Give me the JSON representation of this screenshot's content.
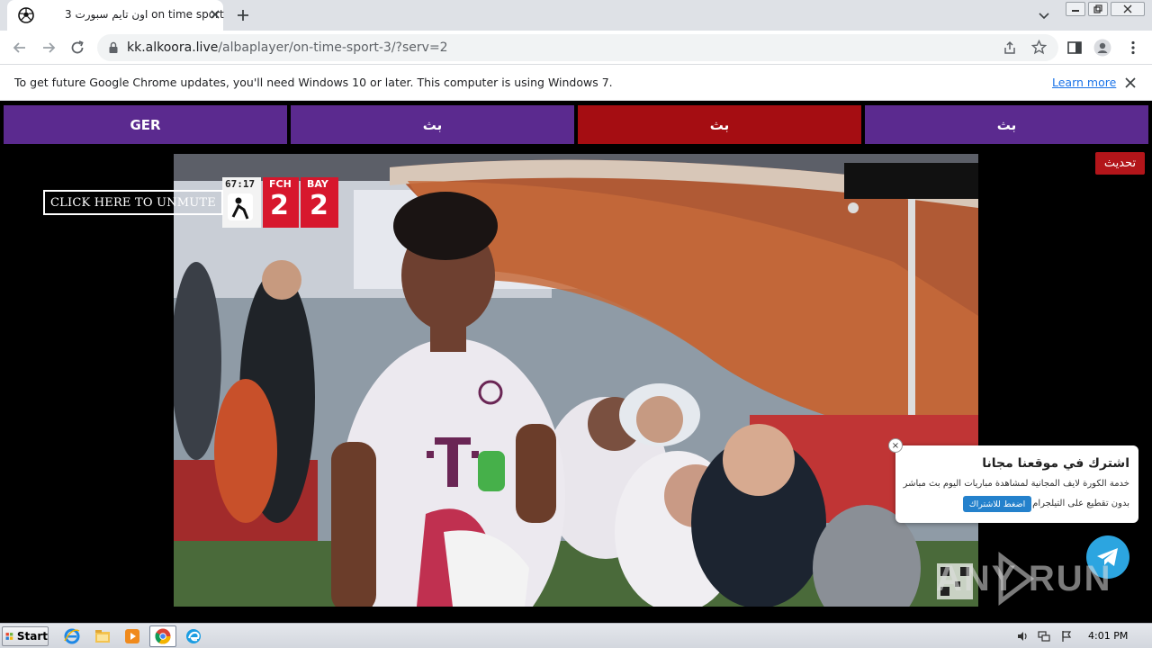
{
  "browser": {
    "tab_title": "اون تايم سبورت 3 on time sport",
    "url_domain": "kk.alkoora.live",
    "url_path": "/albaplayer/on-time-sport-3/?serv=2",
    "infobar_message": "To get future Google Chrome updates, you'll need Windows 10 or later. This computer is using Windows 7.",
    "infobar_link": "Learn more"
  },
  "server_buttons": [
    {
      "label": "GER",
      "color": "#5b2a8f"
    },
    {
      "label": "بث",
      "color": "#5b2a8f"
    },
    {
      "label": "بث",
      "color": "#a50d12"
    },
    {
      "label": "بث",
      "color": "#5b2a8f"
    }
  ],
  "refresh_label": "تحديث",
  "unmute_label": "CLICK HERE TO UNMUTE",
  "scoreboard": {
    "time": "67:17",
    "home_team": "FCH",
    "away_team": "BAY",
    "home_score": "2",
    "away_score": "2"
  },
  "popup": {
    "title": "اشترك في موقعنا مجانا",
    "desc_line1": "خدمة الكورة لايف المجانية لمشاهدة مباريات اليوم بث مباشر",
    "desc_line2": "بدون تقطيع على التيلجرام",
    "button": "اضغط للاشتراك",
    "close": "×"
  },
  "watermark": "ANY RUN",
  "taskbar": {
    "start_label": "Start",
    "clock": "4:01 PM"
  },
  "colors": {
    "purple": "#5b2a8f",
    "red": "#a50d12",
    "telegram": "#2ca5e0"
  }
}
